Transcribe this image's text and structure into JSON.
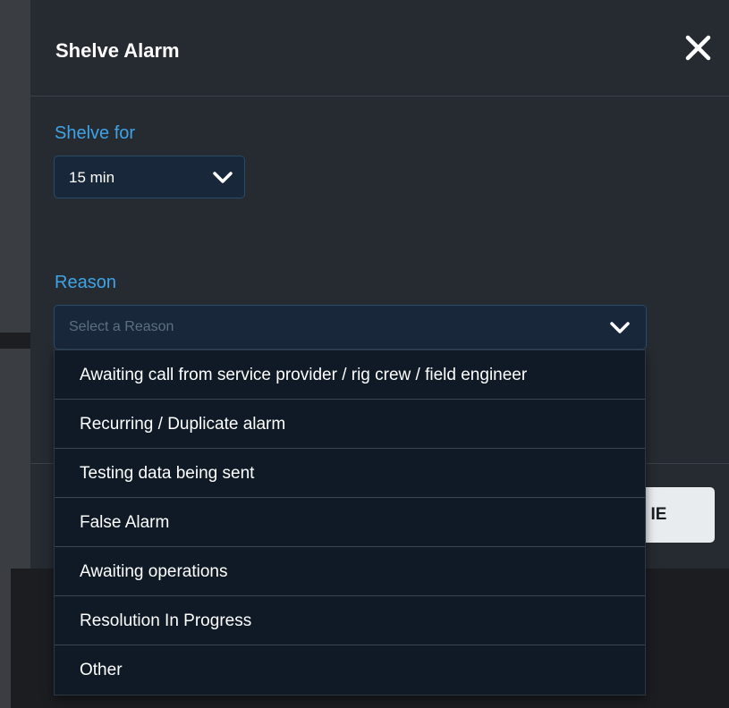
{
  "modal": {
    "title": "Shelve Alarm",
    "close_icon": "close-icon"
  },
  "shelve_for": {
    "label": "Shelve for",
    "selected_value": "15 min"
  },
  "reason": {
    "label": "Reason",
    "placeholder": "Select a Reason",
    "options": [
      "Awaiting call from service provider / rig crew / field engineer",
      "Recurring / Duplicate alarm",
      "Testing data being sent",
      "False Alarm",
      "Awaiting operations",
      "Resolution In Progress",
      "Other"
    ]
  },
  "footer": {
    "shelve_button_label": "IE"
  },
  "colors": {
    "accent": "#3fa3e6",
    "modal_bg": "#262b32",
    "dropdown_bg": "#0f1a26"
  }
}
